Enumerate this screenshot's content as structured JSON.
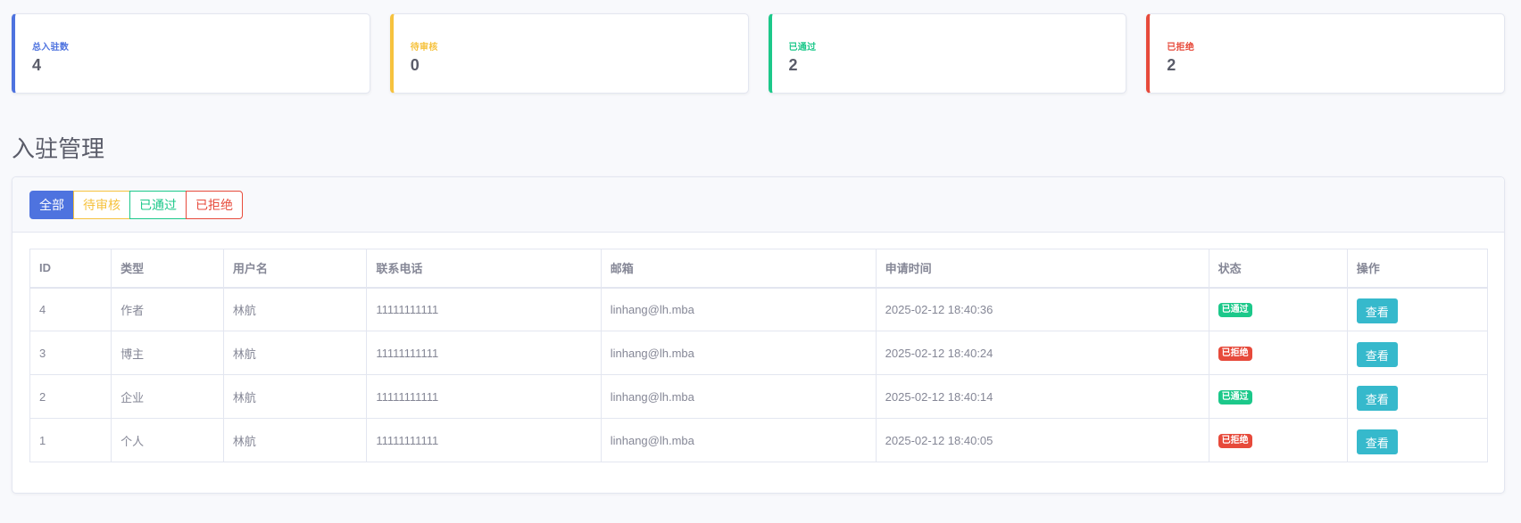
{
  "stats": {
    "total": {
      "label": "总入驻数",
      "value": "4"
    },
    "pending": {
      "label": "待审核",
      "value": "0"
    },
    "approved": {
      "label": "已通过",
      "value": "2"
    },
    "rejected": {
      "label": "已拒绝",
      "value": "2"
    }
  },
  "page_title": "入驻管理",
  "filters": {
    "all": "全部",
    "pending": "待审核",
    "approved": "已通过",
    "rejected": "已拒绝"
  },
  "table": {
    "headers": {
      "id": "ID",
      "type": "类型",
      "username": "用户名",
      "phone": "联系电话",
      "email": "邮箱",
      "time": "申请时间",
      "status": "状态",
      "action": "操作"
    },
    "rows": [
      {
        "id": "4",
        "type": "作者",
        "username": "林航",
        "phone": "11111111111",
        "email": "linhang@lh.mba",
        "time": "2025-02-12 18:40:36",
        "status": "已通过",
        "action": "查看"
      },
      {
        "id": "3",
        "type": "博主",
        "username": "林航",
        "phone": "11111111111",
        "email": "linhang@lh.mba",
        "time": "2025-02-12 18:40:24",
        "status": "已拒绝",
        "action": "查看"
      },
      {
        "id": "2",
        "type": "企业",
        "username": "林航",
        "phone": "11111111111",
        "email": "linhang@lh.mba",
        "time": "2025-02-12 18:40:14",
        "status": "已通过",
        "action": "查看"
      },
      {
        "id": "1",
        "type": "个人",
        "username": "林航",
        "phone": "11111111111",
        "email": "linhang@lh.mba",
        "time": "2025-02-12 18:40:05",
        "status": "已拒绝",
        "action": "查看"
      }
    ]
  },
  "colors": {
    "primary": "#4e73df",
    "warning": "#f6c23e",
    "success": "#1cc88a",
    "danger": "#e74a3b",
    "info": "#36b9cc"
  }
}
